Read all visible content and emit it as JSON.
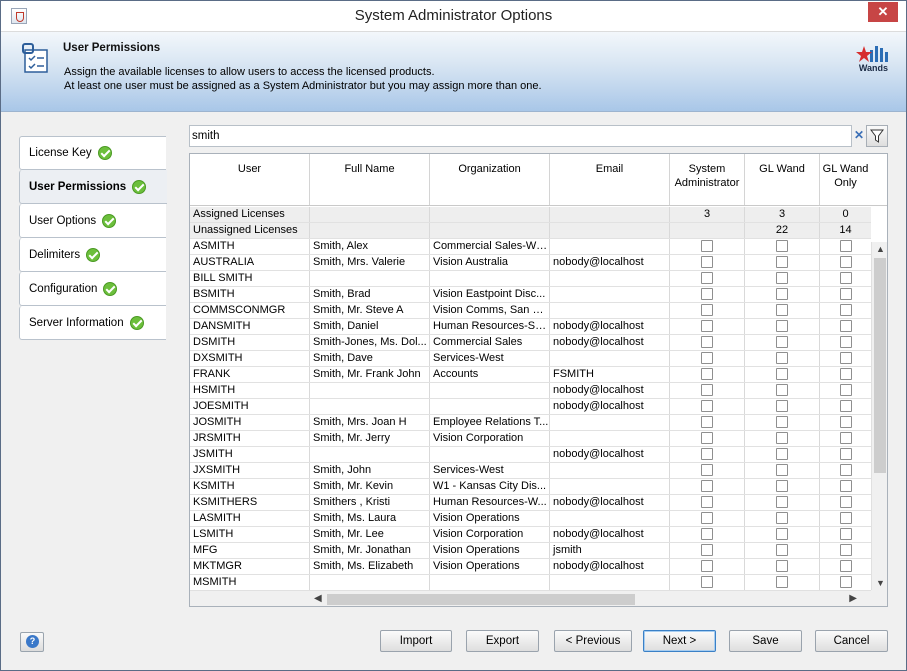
{
  "window": {
    "title": "System Administrator Options",
    "close_label": "✕"
  },
  "header": {
    "title": "User Permissions",
    "line1": "Assign the available licenses to allow users to access the licensed products.",
    "line2": "At least one user must be assigned as a System Administrator but you may assign more than one.",
    "logo_text": "Wands"
  },
  "nav": {
    "items": [
      {
        "label": "License Key",
        "active": false
      },
      {
        "label": "User Permissions",
        "active": true
      },
      {
        "label": "User Options",
        "active": false
      },
      {
        "label": "Delimiters",
        "active": false
      },
      {
        "label": "Configuration",
        "active": false
      },
      {
        "label": "Server Information",
        "active": false
      }
    ]
  },
  "search": {
    "value": "smith"
  },
  "table": {
    "columns": [
      "User",
      "Full Name",
      "Organization",
      "Email",
      "System\nAdministrator",
      "GL Wand",
      "GL Wand\nOnly"
    ],
    "summary": [
      {
        "label": "Assigned Licenses",
        "values": [
          "3",
          "3",
          "0"
        ]
      },
      {
        "label": "Unassigned Licenses",
        "values": [
          "",
          "22",
          "14"
        ]
      }
    ],
    "rows": [
      [
        "ASMITH",
        "Smith, Alex",
        "Commercial Sales-West",
        ""
      ],
      [
        "AUSTRALIA",
        "Smith, Mrs. Valerie",
        "Vision Australia",
        "nobody@localhost"
      ],
      [
        "BILL SMITH",
        "",
        "",
        ""
      ],
      [
        "BSMITH",
        "Smith, Brad",
        "Vision Eastpoint Disc...",
        ""
      ],
      [
        "COMMSCONMGR",
        "Smith, Mr. Steve A",
        "Vision Comms, San Fr...",
        ""
      ],
      [
        "DANSMITH",
        "Smith, Daniel",
        "Human Resources-So...",
        "nobody@localhost"
      ],
      [
        "DSMITH",
        "Smith-Jones, Ms. Dol...",
        "Commercial Sales",
        "nobody@localhost"
      ],
      [
        "DXSMITH",
        "Smith, Dave",
        "Services-West",
        ""
      ],
      [
        "FRANK",
        "Smith, Mr. Frank John",
        "Accounts",
        "FSMITH"
      ],
      [
        "HSMITH",
        "",
        "",
        "nobody@localhost"
      ],
      [
        "JOESMITH",
        "",
        "",
        "nobody@localhost"
      ],
      [
        "JOSMITH",
        "Smith, Mrs. Joan H",
        "Employee Relations T...",
        ""
      ],
      [
        "JRSMITH",
        "Smith, Mr. Jerry",
        "Vision Corporation",
        ""
      ],
      [
        "JSMITH",
        "",
        "",
        "nobody@localhost"
      ],
      [
        "JXSMITH",
        "Smith, John",
        "Services-West",
        ""
      ],
      [
        "KSMITH",
        "Smith, Mr. Kevin",
        "W1 - Kansas City Dis...",
        ""
      ],
      [
        "KSMITHERS",
        "Smithers  , Kristi",
        "Human Resources-W...",
        "nobody@localhost"
      ],
      [
        "LASMITH",
        "Smith, Ms. Laura",
        "Vision Operations",
        ""
      ],
      [
        "LSMITH",
        "Smith, Mr. Lee",
        "Vision Corporation",
        "nobody@localhost"
      ],
      [
        "MFG",
        "Smith, Mr. Jonathan",
        "Vision Operations",
        "jsmith"
      ],
      [
        "MKTMGR",
        "Smith, Ms. Elizabeth",
        "Vision Operations",
        "nobody@localhost"
      ],
      [
        "MSMITH",
        "",
        "",
        ""
      ]
    ]
  },
  "buttons": {
    "import": "Import",
    "export": "Export",
    "previous": "< Previous",
    "next": "Next >",
    "save": "Save",
    "cancel": "Cancel",
    "help": "?"
  },
  "colors": {
    "accent": "#3a80c6",
    "check": "#6cbf3c",
    "close": "#c74545"
  }
}
